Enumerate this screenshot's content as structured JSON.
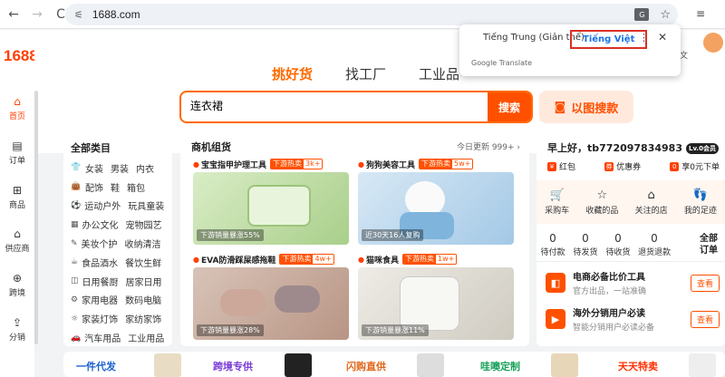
{
  "browser": {
    "url": "1688.com",
    "back": "←",
    "forward": "→",
    "reload": "C"
  },
  "translate_popup": {
    "lang_source": "Tiếng Trung (Giản thể)",
    "lang_target": "Tiếng Việt",
    "brand": "Google Translate"
  },
  "site": {
    "logo": "1688",
    "header_right": "文"
  },
  "sidebar": {
    "items": [
      {
        "label": "首页",
        "icon": "home-icon",
        "glyph": "⌂"
      },
      {
        "label": "订单",
        "icon": "clipboard-icon",
        "glyph": "▤"
      },
      {
        "label": "商品",
        "icon": "grid-icon",
        "glyph": "⊞"
      },
      {
        "label": "供应商",
        "icon": "store-icon",
        "glyph": "⌂"
      },
      {
        "label": "跨境",
        "icon": "globe-icon",
        "glyph": "⊕"
      },
      {
        "label": "分销",
        "icon": "share-icon",
        "glyph": "⇪"
      }
    ]
  },
  "tabs": [
    "挑好货",
    "找工厂",
    "工业品"
  ],
  "search": {
    "value": "连衣裙",
    "button": "搜索",
    "image_search": "以图搜款"
  },
  "categories": {
    "title": "全部类目",
    "rows": [
      {
        "icon": "👕",
        "items": [
          "女装",
          "男装",
          "内衣"
        ]
      },
      {
        "icon": "👜",
        "items": [
          "配饰",
          "鞋",
          "箱包"
        ]
      },
      {
        "icon": "⚽",
        "items": [
          "运动户外",
          "玩具童装"
        ]
      },
      {
        "icon": "▦",
        "items": [
          "办公文化",
          "宠物园艺"
        ]
      },
      {
        "icon": "✎",
        "items": [
          "美妆个护",
          "收纳清洁"
        ]
      },
      {
        "icon": "☕",
        "items": [
          "食品酒水",
          "餐饮生鲜"
        ]
      },
      {
        "icon": "◫",
        "items": [
          "日用餐厨",
          "居家日用"
        ]
      },
      {
        "icon": "⚙",
        "items": [
          "家用电器",
          "数码电脑"
        ]
      },
      {
        "icon": "☼",
        "items": [
          "家装灯饰",
          "家纺家饰"
        ]
      },
      {
        "icon": "🚗",
        "items": [
          "汽车用品",
          "工业用品"
        ]
      }
    ]
  },
  "hot": {
    "title": "商机组货",
    "update": "今日更新 999+ ›",
    "badge_label": "下游热卖",
    "cards": [
      {
        "title": "宝宝指甲护理工具",
        "count": "3k+",
        "caption": "下游销量暴涨55%",
        "bg": "#cfe6b8"
      },
      {
        "title": "狗狗美容工具",
        "count": "5w+",
        "caption": "近30天16人复购",
        "bg": "#bcd8ef"
      },
      {
        "title": "EVA防滑踩屎感拖鞋",
        "count": "4w+",
        "caption": "下游销量暴涨28%",
        "bg": "#c8a89a"
      },
      {
        "title": "猫咪食具",
        "count": "1w+",
        "caption": "下游销量暴涨11%",
        "bg": "#e3e0d8"
      }
    ]
  },
  "user": {
    "greeting": "早上好，tb772097834983",
    "level": "Lv.0会员",
    "perks": [
      {
        "label": "红包",
        "glyph": "¥"
      },
      {
        "label": "优惠券",
        "glyph": "券"
      },
      {
        "label": "享0元下单",
        "glyph": "0"
      }
    ],
    "quick": [
      {
        "label": "采购车",
        "glyph": "🛒"
      },
      {
        "label": "收藏的品",
        "glyph": "☆"
      },
      {
        "label": "关注的店",
        "glyph": "⌂"
      },
      {
        "label": "我的足迹",
        "glyph": "👣"
      }
    ],
    "orders": [
      {
        "count": "0",
        "label": "待付款"
      },
      {
        "count": "0",
        "label": "待发货"
      },
      {
        "count": "0",
        "label": "待收货"
      },
      {
        "count": "0",
        "label": "退货退款"
      }
    ],
    "orders_title": "全部订单",
    "services": [
      {
        "title": "电商必备比价工具",
        "sub": "官方出品，一站准确",
        "btn": "查看",
        "glyph": "◧"
      },
      {
        "title": "海外分销用户必读",
        "sub": "智能分销用户必读必备",
        "btn": "查看",
        "glyph": "▶"
      }
    ]
  },
  "bottom_bar": [
    {
      "label": "一件代发",
      "color": "#1a5fd0"
    },
    {
      "label": "跨境专供",
      "color": "#7a3cd6"
    },
    {
      "label": "闪购直供",
      "color": "#e0661a"
    },
    {
      "label": "哇噢定制",
      "color": "#18a058"
    },
    {
      "label": "天天特卖",
      "color": "#ff3000"
    }
  ],
  "colors": {
    "accent": "#ff5000",
    "brand": "#ff4000"
  }
}
